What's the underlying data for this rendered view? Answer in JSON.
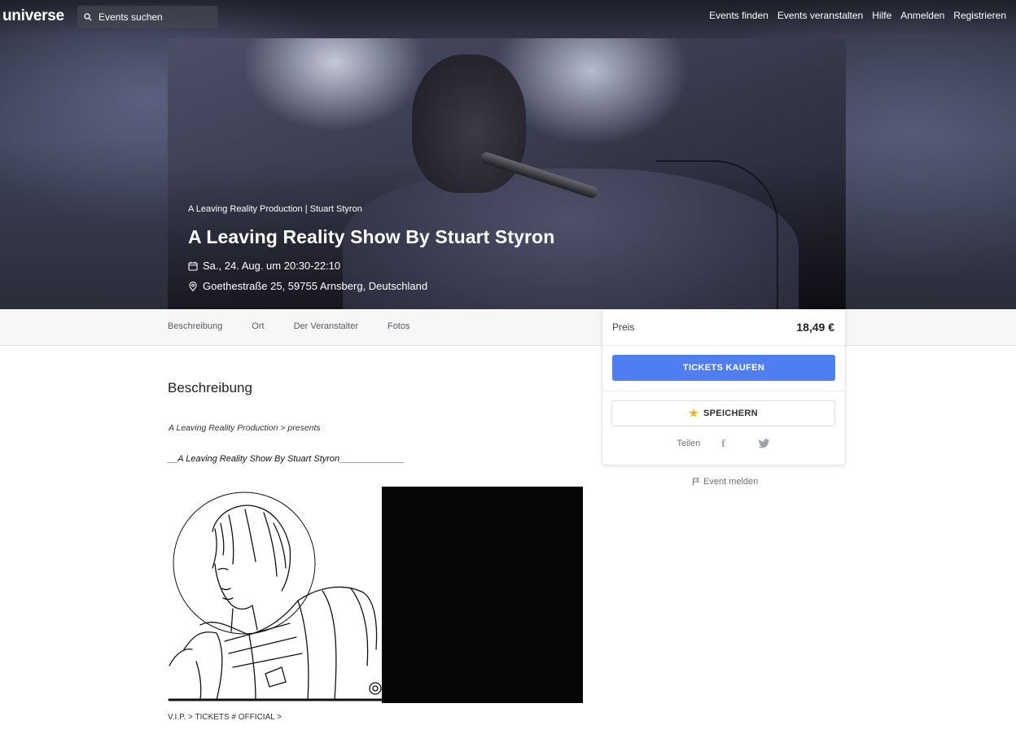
{
  "brand": {
    "logo": "universe"
  },
  "search": {
    "placeholder": "Events suchen"
  },
  "nav": {
    "links": [
      "Events finden",
      "Events veranstalten",
      "Hilfe",
      "Anmelden",
      "Registrieren"
    ]
  },
  "event": {
    "organizer_line": "A Leaving Reality Production | Stuart Styron",
    "title": "A Leaving Reality Show By Stuart Styron",
    "date": "Sa., 24. Aug. um 20:30-22:10",
    "location": "Goethestraße 25, 59755 Arnsberg, Deutschland"
  },
  "tabs": [
    "Beschreibung",
    "Ort",
    "Der Veranstalter",
    "Fotos"
  ],
  "ticket": {
    "price_label": "Preis",
    "price_value": "18,49 €",
    "buy_label": "TICKETS KAUFEN",
    "save_label": "SPEICHERN",
    "share_label": "Teilen",
    "facebook_glyph": "f"
  },
  "report": {
    "label": "Event melden"
  },
  "description": {
    "heading": "Beschreibung",
    "line1": "A Leaving Reality Production > presents",
    "line2": "__A Leaving Reality Show By Stuart Styron_____________",
    "footer_line": "V.I.P. > TICKETS # OFFICIAL >"
  },
  "colors": {
    "accent": "#4e7ef0",
    "star": "#f2b01e"
  },
  "icons": {
    "search": "search-icon",
    "calendar": "calendar-icon",
    "location": "location-pin-icon",
    "star": "star-icon",
    "facebook": "facebook-icon",
    "twitter": "twitter-icon",
    "flag": "flag-icon"
  }
}
